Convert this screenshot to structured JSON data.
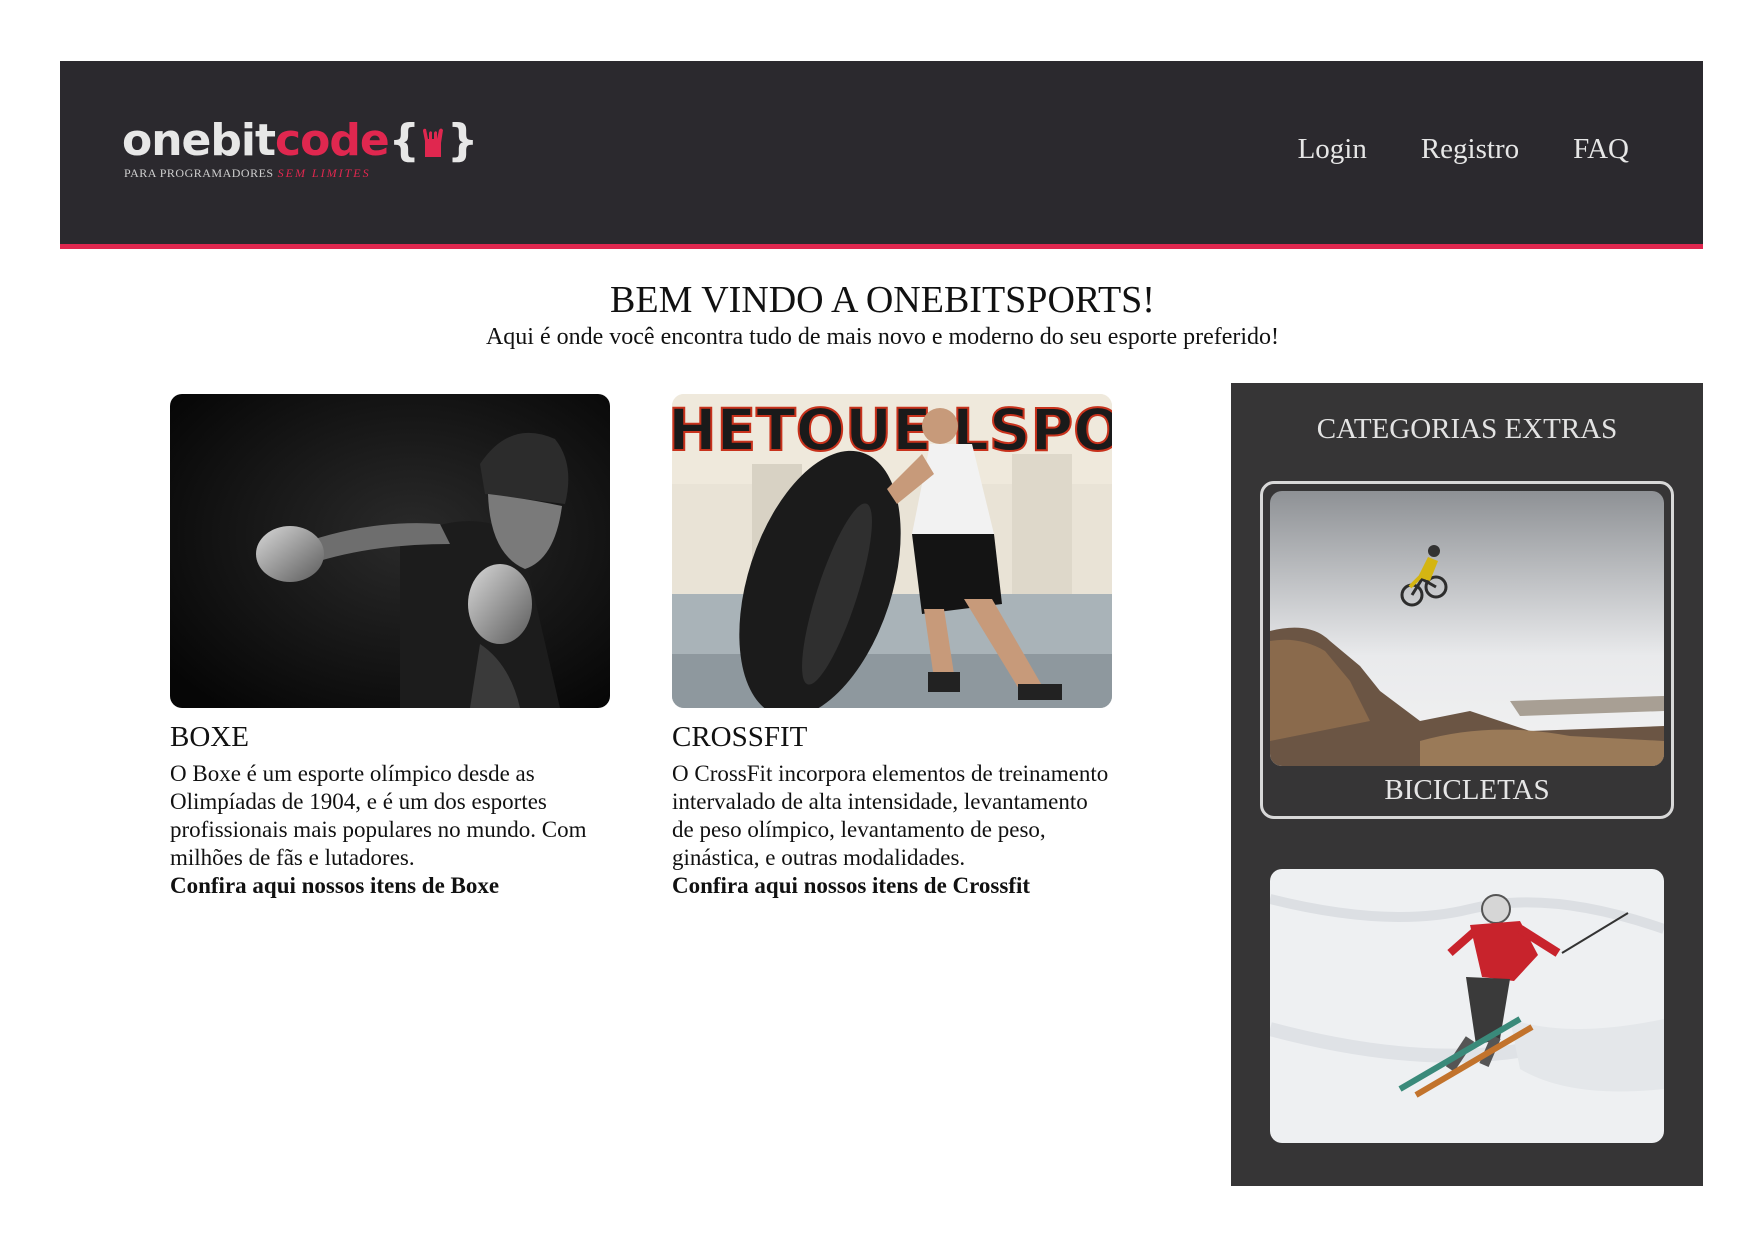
{
  "header": {
    "logo": {
      "part1": "onebit",
      "part2": "code",
      "brace_open": "{",
      "brace_close": "}",
      "tagline_1": "PARA PROGRAMADORES",
      "tagline_2": "SEM LIMITES"
    },
    "nav": [
      {
        "label": "Login"
      },
      {
        "label": "Registro"
      },
      {
        "label": "FAQ"
      }
    ]
  },
  "welcome": {
    "title": "BEM VINDO A ONEBITSPORTS!",
    "subtitle": "Aqui é onde você encontra tudo de mais novo e moderno do seu esporte preferido!"
  },
  "sports": [
    {
      "title": "BOXE",
      "text": "O Boxe é um esporte olímpico desde as Olimpíadas de 1904, e é um dos esportes profissionais mais populares no mundo. Com milhões de fãs e lutadores.",
      "link": "Confira aqui nossos itens de Boxe"
    },
    {
      "title": "CROSSFIT",
      "text": "O CrossFit incorpora elementos de treinamento intervalado de alta intensidade, levantamento de peso olímpico, levantamento de peso, ginástica, e outras modalidades.",
      "link": "Confira aqui nossos itens de Crossfit",
      "wall_text": "HETOUE LSPOT"
    }
  ],
  "sidebar": {
    "title": "CATEGORIAS EXTRAS",
    "categories": [
      {
        "label": "BICICLETAS"
      },
      {
        "label": ""
      }
    ]
  },
  "colors": {
    "header_bg": "#2b292e",
    "accent": "#e0274f",
    "sidebar_bg": "#363536"
  }
}
